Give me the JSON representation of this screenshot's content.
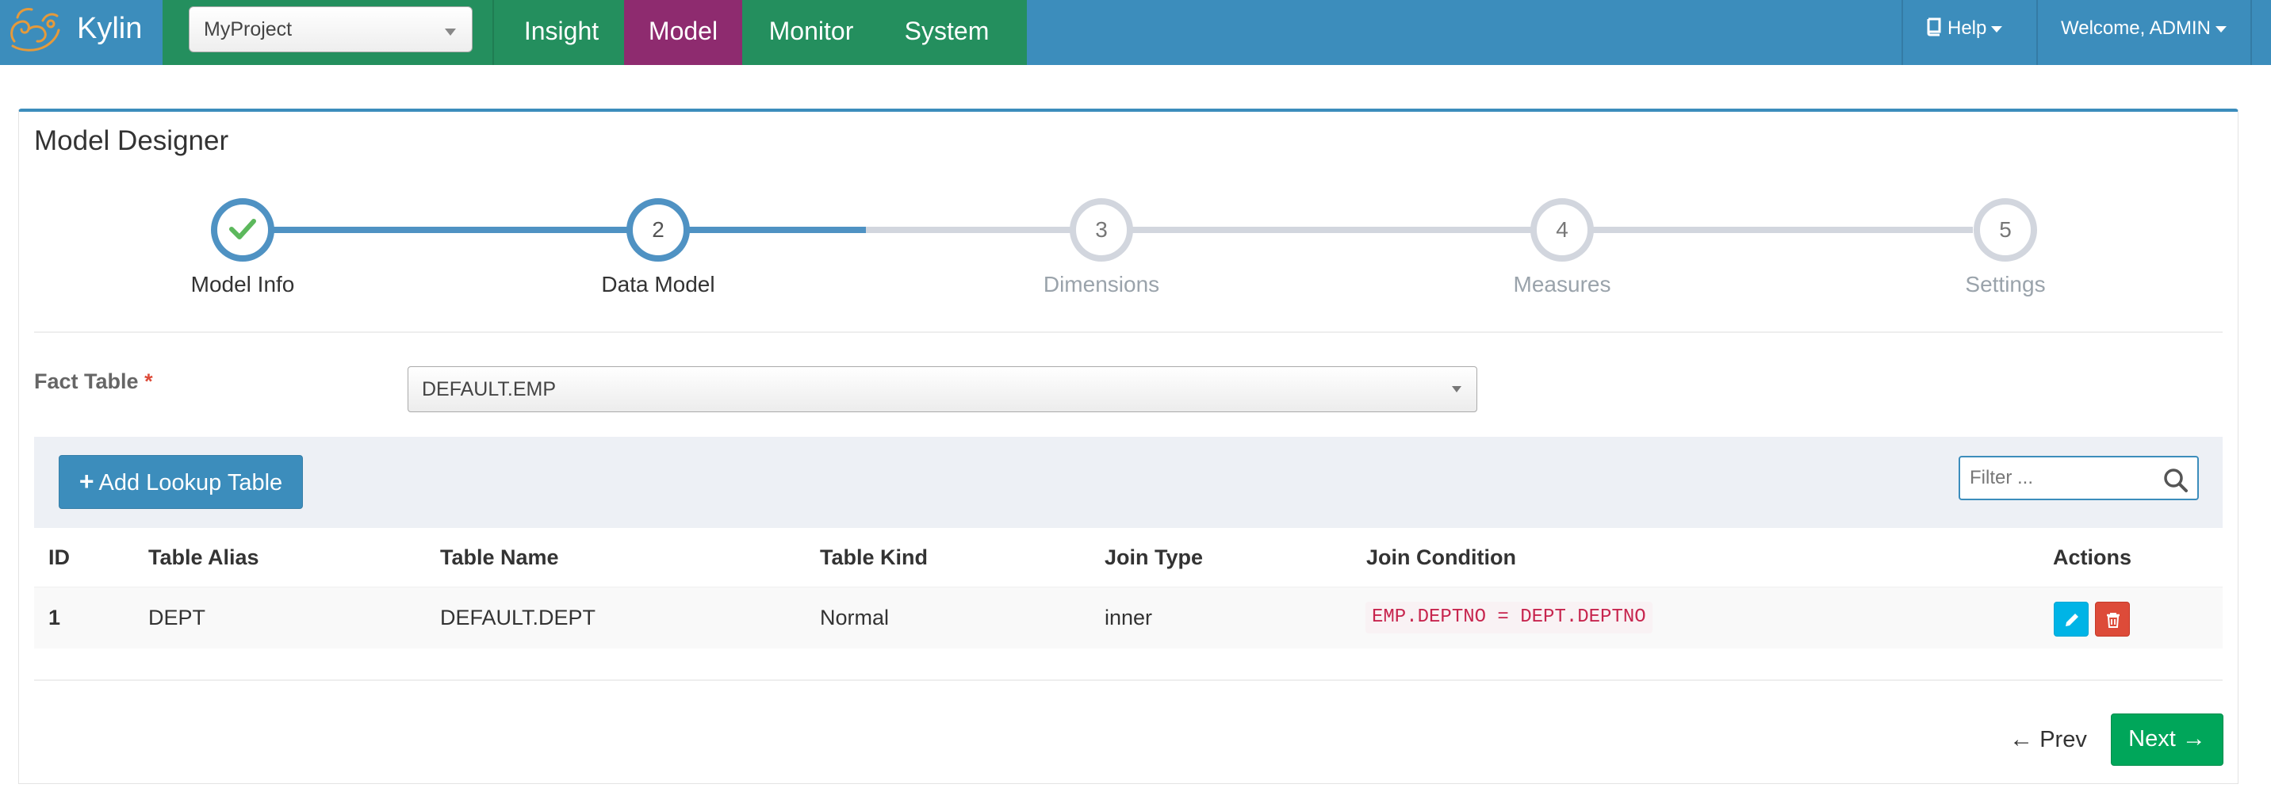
{
  "app": {
    "brand": "Kylin",
    "project": "MyProject"
  },
  "nav": {
    "insight": "Insight",
    "model": "Model",
    "monitor": "Monitor",
    "system": "System",
    "help": "Help",
    "welcome": "Welcome, ADMIN"
  },
  "page": {
    "title": "Model Designer"
  },
  "wizard": {
    "steps": [
      {
        "number": "",
        "label": "Model Info",
        "state": "done"
      },
      {
        "number": "2",
        "label": "Data Model",
        "state": "active"
      },
      {
        "number": "3",
        "label": "Dimensions",
        "state": "pending"
      },
      {
        "number": "4",
        "label": "Measures",
        "state": "pending"
      },
      {
        "number": "5",
        "label": "Settings",
        "state": "pending"
      }
    ]
  },
  "fact_table": {
    "label": "Fact Table",
    "required_mark": "*",
    "value": "DEFAULT.EMP"
  },
  "lookup": {
    "add_button": "Add Lookup Table",
    "filter_placeholder": "Filter ..."
  },
  "table": {
    "headers": [
      "ID",
      "Table Alias",
      "Table Name",
      "Table Kind",
      "Join Type",
      "Join Condition",
      "Actions"
    ],
    "rows": [
      {
        "id": "1",
        "alias": "DEPT",
        "name": "DEFAULT.DEPT",
        "kind": "Normal",
        "join_type": "inner",
        "join_condition": "EMP.DEPTNO = DEPT.DEPTNO"
      }
    ]
  },
  "footer": {
    "prev": "Prev",
    "next": "Next"
  },
  "colors": {
    "header_blue": "#3c8dbc",
    "nav_green": "#248f5e",
    "nav_active": "#8e2b6f",
    "step_done": "#4f92c3",
    "step_pending": "#d2d6de",
    "next_green": "#00a65a",
    "edit_blue": "#00b4e6",
    "delete_red": "#dd4b39"
  },
  "icons": {
    "logo": "kylin-logo-icon",
    "help": "book-icon",
    "step_done": "check-icon",
    "add": "plus-icon",
    "filter": "search-icon",
    "edit": "pencil-icon",
    "delete": "trash-icon",
    "prev": "arrow-left-icon",
    "next": "arrow-right-icon"
  }
}
